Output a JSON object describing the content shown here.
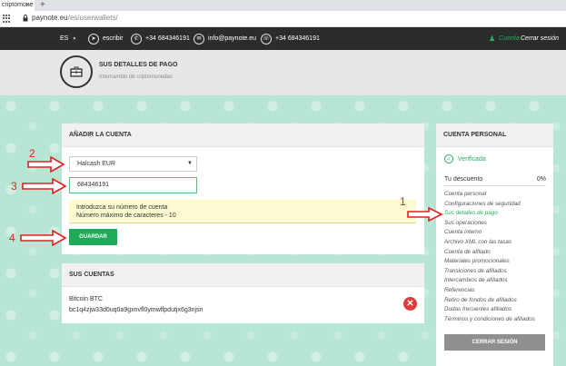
{
  "browser": {
    "tab_title": "criptomone",
    "tab_close": "×",
    "new_tab": "+",
    "url_host": "paynote.eu",
    "url_path": "/es/userwallets/"
  },
  "topbar": {
    "language": "ES",
    "telegram_label": "escribir",
    "whatsapp_phone": "+34 684346191",
    "email": "info@paynote.eu",
    "phone": "+34 684346191",
    "user_label": "Cuenta",
    "logout_label": "Cerrar sesión"
  },
  "header": {
    "title": "SUS DETALLES DE PAGO",
    "subtitle": "Intercambio de criptomonedas"
  },
  "add_account": {
    "heading": "AÑADIR LA CUENTA",
    "select_value": "Halcash EUR",
    "input_value": "684346191",
    "hint_line1": "Introduzca su número de cuenta",
    "hint_line2": "Número máximo de caracteres - 10",
    "save_label": "GUARDAR"
  },
  "your_accounts": {
    "heading": "SUS CUENTAS",
    "items": [
      {
        "label": "Bitcoin BTC",
        "address": "bc1q4zjw33d0uq0a9gxnvfl0ymwlfpdutjx6g3njsn"
      }
    ]
  },
  "sidebar": {
    "heading": "CUENTA PERSONAL",
    "verified_label": "Verificada",
    "discount_label": "Tu descuento",
    "discount_value": "0%",
    "menu": [
      "Cuenta personal",
      "Configuraciones de seguridad",
      "Sus detalles de pago",
      "Sus operaciones",
      "Cuenta interno",
      "Archivo XML con las tasas",
      "Cuenta de afiliado",
      "Materiales promocionales",
      "Transiciones de afiliados",
      "Intercambios de afiliados",
      "Referencias",
      "Retiro de fondos de afiliados",
      "Dudas frecuentes afiliados",
      "Términos y condiciones de afiliados"
    ],
    "active_index": 2,
    "logout_label": "CERRAR SESIÓN"
  },
  "annotations": [
    "1",
    "2",
    "3",
    "4"
  ],
  "colors": {
    "accent_green": "#1dab58",
    "annotation_red": "#e02020",
    "background_green": "#b8e6d5",
    "topbar_dark": "#2a2d2c"
  }
}
